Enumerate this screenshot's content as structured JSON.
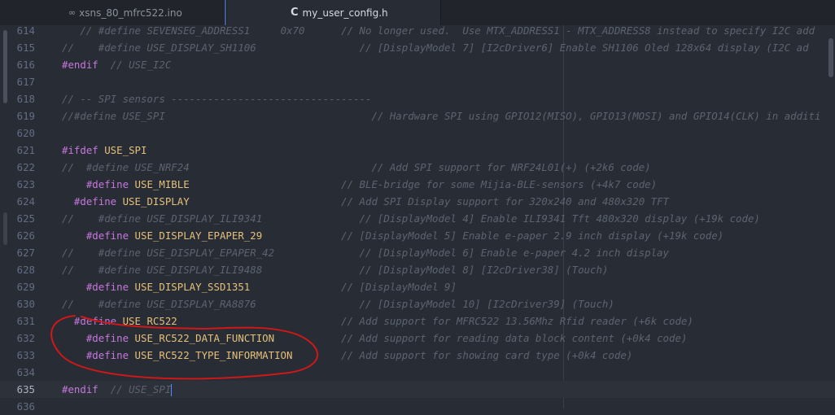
{
  "tabs": {
    "inactive_label": "xsns_80_mfrc522.ino",
    "inactive_icon": "∞",
    "active_label": "my_user_config.h",
    "active_icon": "C"
  },
  "editor": {
    "lines": [
      {
        "num": "614",
        "indent": "   ",
        "kw": "",
        "id": "",
        "cm": "// #define SEVENSEG_ADDRESS1     0x70      // No longer used.  Use MTX_ADDRESS1 - MTX_ADDRESS8 instead to specify I2C add"
      },
      {
        "num": "615",
        "indent": "",
        "kw": "",
        "id": "",
        "cm": "//    #define USE_DISPLAY_SH1106                 // [DisplayModel 7] [I2cDriver6] Enable SH1106 Oled 128x64 display (I2C ad"
      },
      {
        "num": "616",
        "indent": "",
        "kw": "#endif",
        "id": "",
        "cm": "  // USE_I2C"
      },
      {
        "num": "617",
        "indent": "",
        "kw": "",
        "id": "",
        "cm": ""
      },
      {
        "num": "618",
        "indent": "",
        "kw": "",
        "id": "",
        "cm": "// -- SPI sensors ---------------------------------"
      },
      {
        "num": "619",
        "indent": "",
        "kw": "",
        "id": "",
        "cm": "//#define USE_SPI                                  // Hardware SPI using GPIO12(MISO), GPIO13(MOSI) and GPIO14(CLK) in additi"
      },
      {
        "num": "620",
        "indent": "",
        "kw": "",
        "id": "",
        "cm": ""
      },
      {
        "num": "621",
        "indent": "",
        "kw": "#ifdef",
        "id": " USE_SPI",
        "cm": ""
      },
      {
        "num": "622",
        "indent": "",
        "kw": "",
        "id": "",
        "cm": "//  #define USE_NRF24                              // Add SPI support for NRF24L01(+) (+2k6 code)"
      },
      {
        "num": "623",
        "indent": "    ",
        "kw": "#define",
        "id": " USE_MIBLE",
        "cm": "                         // BLE-bridge for some Mijia-BLE-sensors (+4k7 code)"
      },
      {
        "num": "624",
        "indent": "  ",
        "kw": "#define",
        "id": " USE_DISPLAY",
        "cm": "                         // Add SPI Display support for 320x240 and 480x320 TFT"
      },
      {
        "num": "625",
        "indent": "",
        "kw": "",
        "id": "",
        "cm": "//    #define USE_DISPLAY_ILI9341                // [DisplayModel 4] Enable ILI9341 Tft 480x320 display (+19k code)"
      },
      {
        "num": "626",
        "indent": "    ",
        "kw": "#define",
        "id": " USE_DISPLAY_EPAPER_29",
        "cm": "             // [DisplayModel 5] Enable e-paper 2.9 inch display (+19k code)"
      },
      {
        "num": "627",
        "indent": "",
        "kw": "",
        "id": "",
        "cm": "//    #define USE_DISPLAY_EPAPER_42              // [DisplayModel 6] Enable e-paper 4.2 inch display"
      },
      {
        "num": "628",
        "indent": "",
        "kw": "",
        "id": "",
        "cm": "//    #define USE_DISPLAY_ILI9488                // [DisplayModel 8] [I2cDriver38] (Touch)"
      },
      {
        "num": "629",
        "indent": "    ",
        "kw": "#define",
        "id": " USE_DISPLAY_SSD1351",
        "cm": "               // [DisplayModel 9]"
      },
      {
        "num": "630",
        "indent": "",
        "kw": "",
        "id": "",
        "cm": "//    #define USE_DISPLAY_RA8876                 // [DisplayModel 10] [I2cDriver39] (Touch)"
      },
      {
        "num": "631",
        "indent": "  ",
        "kw": "#define",
        "id": " USE_RC522",
        "cm": "                           // Add support for MFRC522 13.56Mhz Rfid reader (+6k code)"
      },
      {
        "num": "632",
        "indent": "    ",
        "kw": "#define",
        "id": " USE_RC522_DATA_FUNCTION",
        "cm": "           // Add support for reading data block content (+0k4 code)"
      },
      {
        "num": "633",
        "indent": "    ",
        "kw": "#define",
        "id": " USE_RC522_TYPE_INFORMATION",
        "cm": "        // Add support for showing card type (+0k4 code)"
      },
      {
        "num": "634",
        "indent": "",
        "kw": "",
        "id": "",
        "cm": ""
      },
      {
        "num": "635",
        "indent": "",
        "kw": "#endif",
        "id": "",
        "cm": "  // USE_SPI",
        "current": true
      },
      {
        "num": "636",
        "indent": "",
        "kw": "",
        "id": "",
        "cm": ""
      }
    ]
  },
  "colors": {
    "annotation": "#d01818"
  }
}
